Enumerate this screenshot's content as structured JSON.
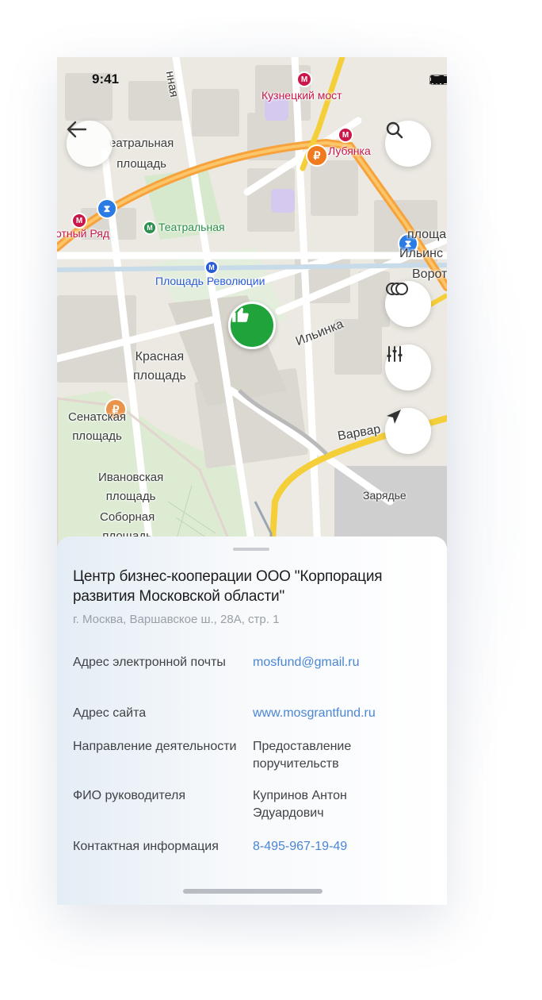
{
  "status_bar": {
    "time": "9:41"
  },
  "map": {
    "labels": {
      "teatralnaya_ploshchad": "еатральная\nплощадь",
      "kuznetsky_most": "Кузнецкий мост",
      "lubyanka": "Лубянка",
      "okhotny_ryad": "отный Ряд",
      "teatralnaya_metro": "Театральная",
      "ploshchad_revolyutsii": "Площадь Революции",
      "krasnaya_ploshchad": "Красная\nплощадь",
      "ilyinka": "Ильинка",
      "senatskaya_ploshchad": "Сенатская\nплощадь",
      "ivanovskaya_ploshchad": "Ивановская\nплощадь",
      "sobornaya_ploshchad": "Соборная\nплощадь",
      "varvarka": "Варвар",
      "zaryadye": "Зарядье",
      "ploshcha": "площа",
      "ilyinskaya": "Ильинс",
      "vorot": "Ворот",
      "street_top": "нная"
    },
    "colors": {
      "road_major": "#f7a23b",
      "road_yellow": "#f5cf3a",
      "pin_green": "#1fa33a",
      "ruble_orange": "#f07a1e",
      "metro_red": "#c9174a"
    }
  },
  "buttons": {
    "back": "back-arrow-icon",
    "search": "search-icon",
    "layers": "layers-icon",
    "filters": "filter-sliders-icon",
    "locate": "location-arrow-icon"
  },
  "sheet": {
    "title": "Центр бизнес-кооперации ООО \"Корпорация развития Московской области\"",
    "address": "г. Москва, Варшавское ш., 28А, стр. 1",
    "rows": [
      {
        "label": "Адрес электронной почты",
        "value": "mosfund@gmail.ru"
      },
      {
        "label": "Адрес сайта",
        "value": "www.mosgrantfund.ru"
      },
      {
        "label": "Направление деятельности",
        "value": "Предоставление поручительств"
      },
      {
        "label": "ФИО руководителя",
        "value": "Купринов Антон Эдуардович"
      },
      {
        "label": "Контактная информация",
        "value": "8-495-967-19-49"
      }
    ]
  }
}
